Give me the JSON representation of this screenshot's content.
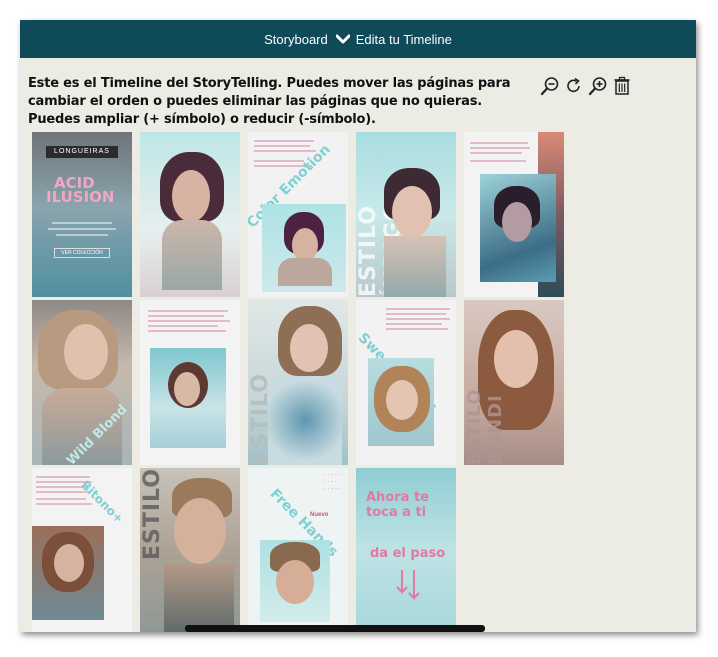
{
  "header": {
    "title": "Storyboard",
    "subtitle": "Edita tu Timeline",
    "bg_color": "#0e4a57"
  },
  "intro_text": "Este es el Timeline del StoryTelling. Puedes mover las páginas para cambiar el orden o puedes eliminar las páginas que no quieras. Puedes ampliar (+ símbolo) o reducir (-símbolo).",
  "toolbar": {
    "icons": [
      "zoom-out-icon",
      "refresh-icon",
      "zoom-in-icon",
      "trash-icon"
    ]
  },
  "pages": {
    "p1": {
      "brand": "LONGUEIRAS",
      "title1": "ACID",
      "title2": "ILUSION",
      "cta": "VER COLECCIÓN"
    },
    "p3": {
      "label": "Color Emotion"
    },
    "p4": {
      "label": "ESTILO ÍNDIGO"
    },
    "p6": {
      "label": "Wild Blond"
    },
    "p8": {
      "label": "ESTILO OPAL"
    },
    "p9": {
      "label": "Sweet Waves"
    },
    "p10": {
      "label": "ESTILO BONDI"
    },
    "p11": {
      "label": "Bitono+"
    },
    "p12": {
      "label": "ESTILO"
    },
    "p13": {
      "label": "Free Hands",
      "tag": "Nuevo"
    },
    "p14": {
      "line1": "Ahora te",
      "line2": "toca a ti",
      "line3": "da el paso"
    }
  }
}
